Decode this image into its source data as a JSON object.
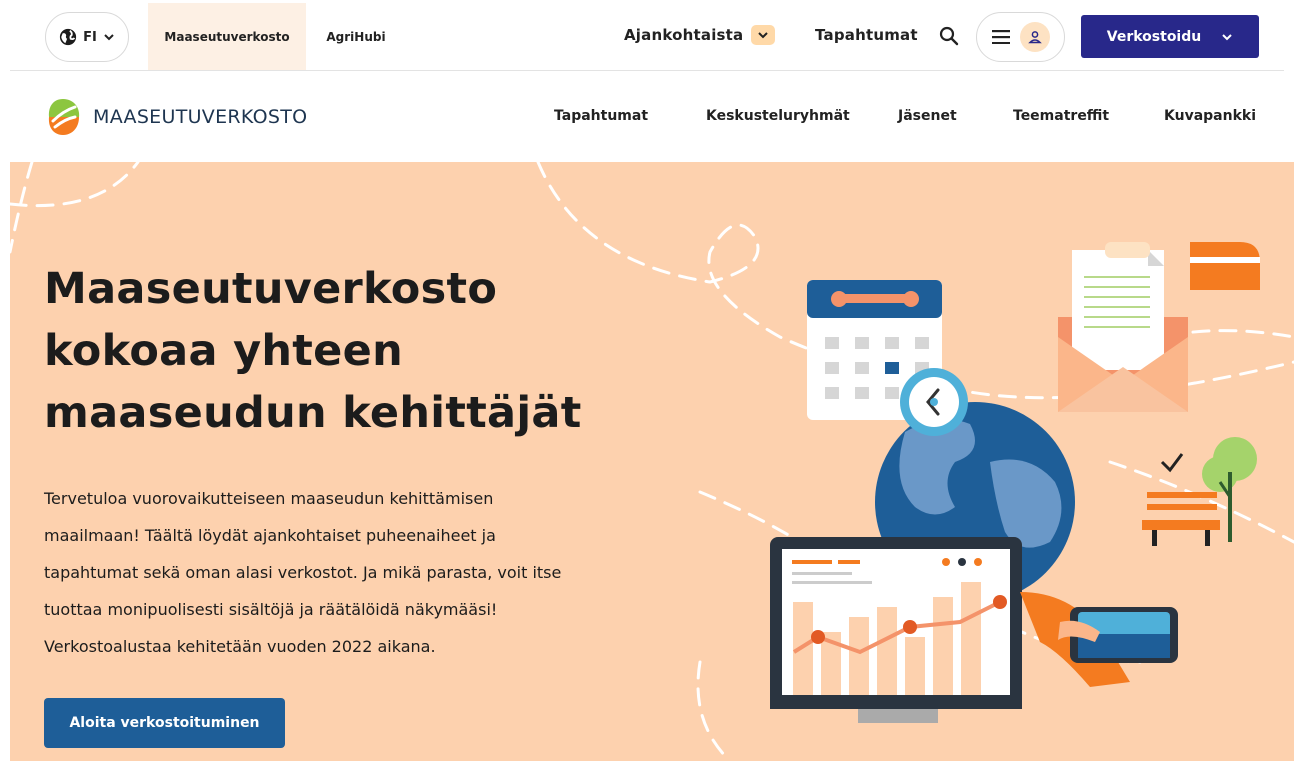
{
  "topbar": {
    "language": "FI",
    "tabs": [
      {
        "label": "Maaseutuverkosto",
        "active": true
      },
      {
        "label": "AgriHubi",
        "active": false
      }
    ],
    "ajankohtaista": "Ajankohtaista",
    "tapahtumat": "Tapahtumat",
    "cta_label": "Verkostoidu",
    "accent_color": "#28288a",
    "icons": {
      "language": "globe-icon",
      "search": "search-icon",
      "menu": "hamburger-menu-icon",
      "user": "user-icon"
    }
  },
  "brand": {
    "name": "MAASEUTUVERKOSTO"
  },
  "main_nav": [
    {
      "label": "Tapahtumat"
    },
    {
      "label": "Keskusteluryhmät"
    },
    {
      "label": "Jäsenet"
    },
    {
      "label": "Teematreffit"
    },
    {
      "label": "Kuvapankki"
    }
  ],
  "hero": {
    "title_lines": [
      "Maaseutuverkosto",
      "kokoaa yhteen",
      "maaseudun kehittäjät"
    ],
    "text_lines": [
      "Tervetuloa vuorovaikutteiseen maaseudun kehittämisen",
      "maailmaan! Täältä löydät ajankohtaiset puheenaiheet ja",
      "tapahtumat sekä oman alasi verkostot. Ja mikä parasta, voit itse",
      "tuottaa monipuolisesti sisältöjä ja räätälöidä näkymääsi!",
      "Verkostoalustaa kehitetään vuoden 2022 aikana."
    ],
    "button_label": "Aloita verkostoituminen",
    "background_color": "#fdd1ae",
    "button_color": "#1e5e98"
  }
}
